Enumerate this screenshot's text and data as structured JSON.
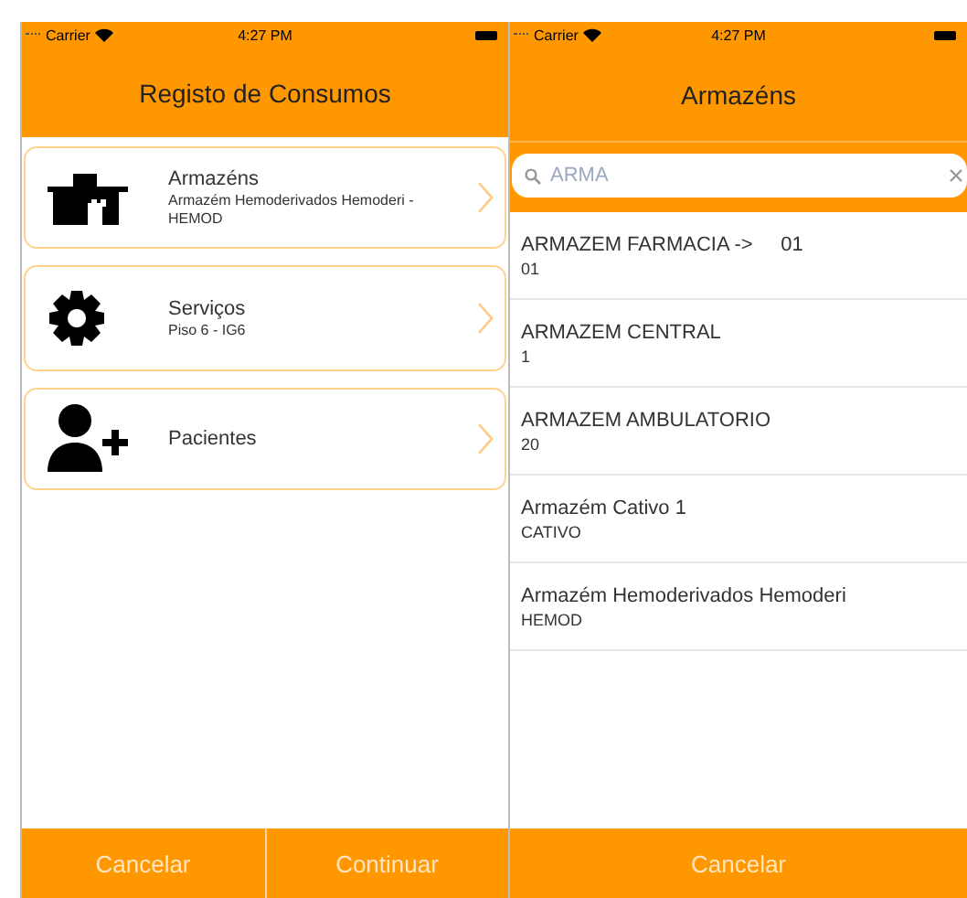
{
  "screens": [
    {
      "status_bar": {
        "carrier": "Carrier",
        "time": "4:27 PM"
      },
      "title": "Registo de Consumos",
      "menu": [
        {
          "kind": "warehouse",
          "title": "Armazéns",
          "subtitle": "Armazém Hemoderivados Hemoderi - HEMOD"
        },
        {
          "kind": "gear",
          "title": "Serviços",
          "subtitle": "Piso 6 - IG6"
        },
        {
          "kind": "person-add",
          "title": "Pacientes"
        }
      ],
      "buttons": [
        "Cancelar",
        "Continuar"
      ]
    },
    {
      "status_bar": {
        "carrier": "Carrier",
        "time": "4:27 PM"
      },
      "title": "Armazéns",
      "search": {
        "value": "ARMA"
      },
      "list": [
        {
          "name": "ARMAZEM FARMACIA ->     01",
          "code": "01"
        },
        {
          "name": "ARMAZEM CENTRAL",
          "code": "1"
        },
        {
          "name": "ARMAZEM AMBULATORIO",
          "code": "20"
        },
        {
          "name": "Armazém Cativo 1",
          "code": "CATIVO"
        },
        {
          "name": "Armazém Hemoderivados Hemoderi",
          "code": "HEMOD"
        }
      ],
      "buttons": [
        "Cancelar"
      ]
    }
  ]
}
